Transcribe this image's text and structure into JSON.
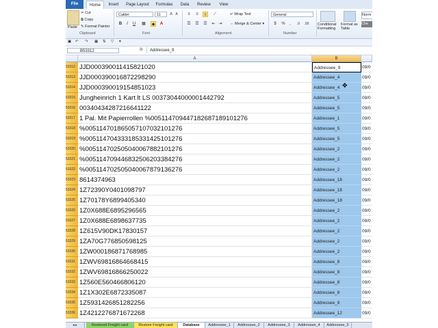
{
  "ribbon": {
    "tabs": [
      "File",
      "Home",
      "Insert",
      "Page Layout",
      "Formulas",
      "Data",
      "Review",
      "View"
    ],
    "clipboard": {
      "paste": "Paste",
      "cut": "Cut",
      "copy": "Copy",
      "format_painter": "Format Painter",
      "label": "Clipboard"
    },
    "font": {
      "name": "Calibri",
      "size": "11",
      "bold": "B",
      "italic": "I",
      "underline": "U",
      "label": "Font"
    },
    "alignment": {
      "wrap_text": "Wrap Text",
      "merge_center": "Merge & Center",
      "label": "Alignment"
    },
    "number": {
      "format": "General",
      "label": "Number"
    },
    "styles": {
      "conditional": "Conditional Formatting",
      "format_table": "Format as Table",
      "normal": "Norm",
      "check": "Che"
    }
  },
  "formula_bar": {
    "cell_ref": "B53312",
    "fx": "fx",
    "value": "Addressee_9"
  },
  "columns": [
    "A",
    "B"
  ],
  "rows": [
    {
      "n": "53312",
      "a": "JJD000390011415821020",
      "b": "Addressee_9",
      "c": "09/0"
    },
    {
      "n": "53313",
      "a": "JJD000390016872298290",
      "b": "Addressee_4",
      "c": "09/0"
    },
    {
      "n": "53314",
      "a": "JJD000390019154851023",
      "b": "Addressee_4",
      "c": "09/0"
    },
    {
      "n": "53315",
      "a": "Jungheinrich 1 Kart lt LS 00373044000001442792",
      "b": "Addressee_5",
      "c": "09/0"
    },
    {
      "n": "53316",
      "a": "00340434287216641122",
      "b": "Addressee_5",
      "c": "09/0"
    },
    {
      "n": "53317",
      "a": "1 Pal. Mit Papierrollen %005114709447182687189101276",
      "b": "Addressee_1",
      "c": "09/0"
    },
    {
      "n": "53318",
      "a": "%005114701865057107032101276",
      "b": "Addressee_5",
      "c": "09/0"
    },
    {
      "n": "53319",
      "a": "%005114704333185331425101276",
      "b": "Addressee_5",
      "c": "09/0"
    },
    {
      "n": "53320",
      "a": "%005114702505040067882101276",
      "b": "Addressee_2",
      "c": "09/0"
    },
    {
      "n": "53321",
      "a": "%005114709446832506203384276",
      "b": "Addressee_2",
      "c": "09/0"
    },
    {
      "n": "53322",
      "a": "%005114702505040067879136276",
      "b": "Addressee_2",
      "c": "09/0"
    },
    {
      "n": "53323",
      "a": "8614374963",
      "b": "Addressee_18",
      "c": "09/0"
    },
    {
      "n": "53324",
      "a": "1Z72390Y0401098797",
      "b": "Addressee_18",
      "c": "09/0"
    },
    {
      "n": "53325",
      "a": "1Z70178Y6899405340",
      "b": "Addressee_18",
      "c": "09/0"
    },
    {
      "n": "53326",
      "a": "1Z0X688E6895296565",
      "b": "Addressee_2",
      "c": "09/0"
    },
    {
      "n": "53327",
      "a": "1Z0X688E6898637735",
      "b": "Addressee_2",
      "c": "09/0"
    },
    {
      "n": "53328",
      "a": "1Z615V90DK17830157",
      "b": "Addressee_2",
      "c": "09/0"
    },
    {
      "n": "53329",
      "a": "1ZA70G776850598125",
      "b": "Addressee_2",
      "c": "09/0"
    },
    {
      "n": "53330",
      "a": "1ZW000186871768985",
      "b": "Addressee_2",
      "c": "09/0"
    },
    {
      "n": "53331",
      "a": "1ZWV69816864668415",
      "b": "Addressee_8",
      "c": "09/0"
    },
    {
      "n": "53332",
      "a": "1ZWV69816866250022",
      "b": "Addressee_8",
      "c": "09/0"
    },
    {
      "n": "53333",
      "a": "1Z560E560466806120",
      "b": "Addressee_8",
      "c": "09/0"
    },
    {
      "n": "53334",
      "a": "1Z1X302E6872335087",
      "b": "Addressee_8",
      "c": "09/0"
    },
    {
      "n": "53335",
      "a": "1Z5931426851282256",
      "b": "Addressee_9",
      "c": "09/0"
    },
    {
      "n": "53336",
      "a": "1Z4212276871672268",
      "b": "Addressee_12",
      "c": "09/0"
    }
  ],
  "sheet_tabs": [
    {
      "label": "Restored Freight card",
      "style": "green"
    },
    {
      "label": "Restore Freight card",
      "style": "yellow"
    },
    {
      "label": "Database",
      "style": "active"
    },
    {
      "label": "Addressee_1",
      "style": "plain"
    },
    {
      "label": "Addressee_2",
      "style": "plain"
    },
    {
      "label": "Addressee_3",
      "style": "plain"
    },
    {
      "label": "Addressee_4",
      "style": "plain"
    },
    {
      "label": "Addressee_5",
      "style": "plain"
    }
  ],
  "colors": {
    "file_tab": "#2a6ab5",
    "selection": "#9ec8ec",
    "row_header": "#f0b638"
  }
}
